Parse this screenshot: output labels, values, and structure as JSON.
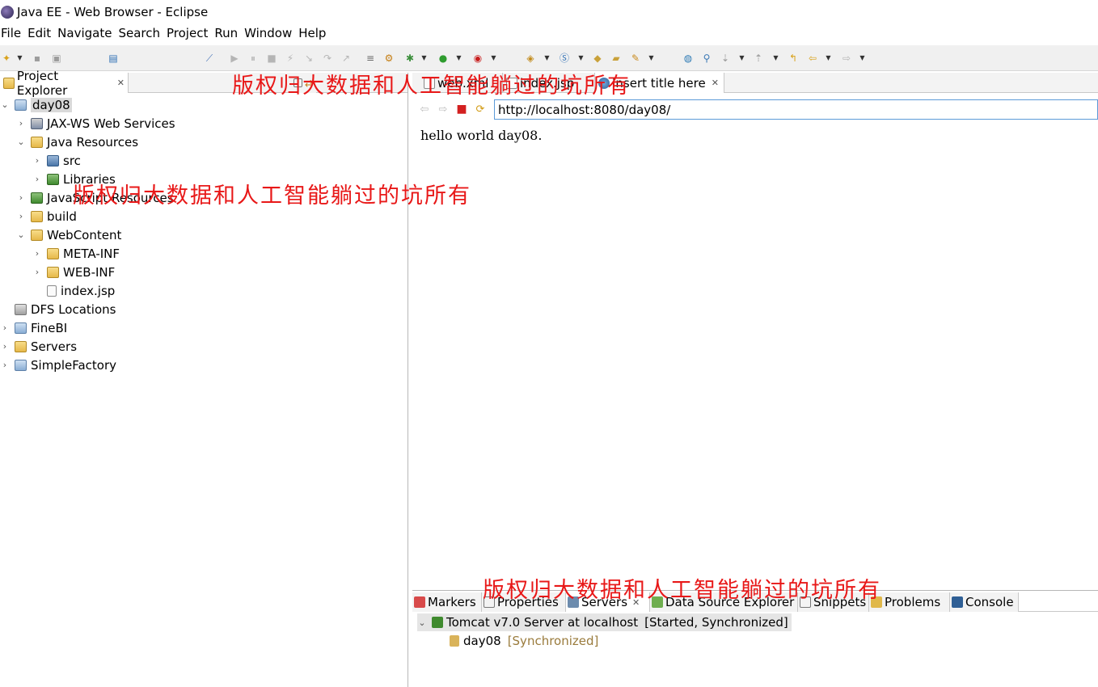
{
  "window": {
    "title": "Java EE - Web Browser - Eclipse"
  },
  "menu": [
    "File",
    "Edit",
    "Navigate",
    "Search",
    "Project",
    "Run",
    "Window",
    "Help"
  ],
  "project_explorer": {
    "tab_label": "Project Explorer",
    "tree": [
      {
        "label": "day08",
        "icon": "web-project-icon",
        "expanded": true,
        "selected": true
      },
      {
        "label": "JAX-WS Web Services",
        "icon": "web-services-icon",
        "expanded": false
      },
      {
        "label": "Java Resources",
        "icon": "java-resources-icon",
        "expanded": true
      },
      {
        "label": "src",
        "icon": "source-folder-icon",
        "expanded": false
      },
      {
        "label": "Libraries",
        "icon": "libraries-icon",
        "expanded": false
      },
      {
        "label": "JavaScript Resources",
        "icon": "javascript-resources-icon",
        "expanded": false
      },
      {
        "label": "build",
        "icon": "folder-icon",
        "expanded": false
      },
      {
        "label": "WebContent",
        "icon": "folder-icon",
        "expanded": true
      },
      {
        "label": "META-INF",
        "icon": "folder-icon",
        "expanded": false
      },
      {
        "label": "WEB-INF",
        "icon": "folder-icon",
        "expanded": false
      },
      {
        "label": "index.jsp",
        "icon": "jsp-file-icon"
      },
      {
        "label": "DFS Locations",
        "icon": "dfs-locations-icon"
      },
      {
        "label": "FineBI",
        "icon": "project-icon",
        "expanded": false
      },
      {
        "label": "Servers",
        "icon": "servers-folder-icon",
        "expanded": false
      },
      {
        "label": "SimpleFactory",
        "icon": "project-icon",
        "expanded": false
      }
    ]
  },
  "editor": {
    "tabs": [
      {
        "label": "web.xml",
        "icon": "xml-file-icon"
      },
      {
        "label": "index.jsp",
        "icon": "jsp-file-icon"
      },
      {
        "label": "Insert title here",
        "icon": "browser-icon",
        "active": true
      }
    ],
    "url": "http://localhost:8080/day08/",
    "page_text": "hello world day08."
  },
  "bottom_panel": {
    "tabs": [
      {
        "label": "Markers",
        "icon": "markers-icon"
      },
      {
        "label": "Properties",
        "icon": "properties-icon"
      },
      {
        "label": "Servers",
        "icon": "servers-icon",
        "active": true
      },
      {
        "label": "Data Source Explorer",
        "icon": "data-source-icon"
      },
      {
        "label": "Snippets",
        "icon": "snippets-icon"
      },
      {
        "label": "Problems",
        "icon": "problems-icon"
      },
      {
        "label": "Console",
        "icon": "console-icon"
      }
    ],
    "servers": [
      {
        "label": "Tomcat v7.0 Server at localhost",
        "status": "[Started, Synchronized]"
      },
      {
        "label": "day08",
        "status": "[Synchronized]"
      }
    ]
  },
  "watermark": "版权归大数据和人工智能躺过的坑所有",
  "colors": {
    "watermark": "#e81818",
    "url_border": "#5c9ad8",
    "selection": "#d9d9d9"
  }
}
